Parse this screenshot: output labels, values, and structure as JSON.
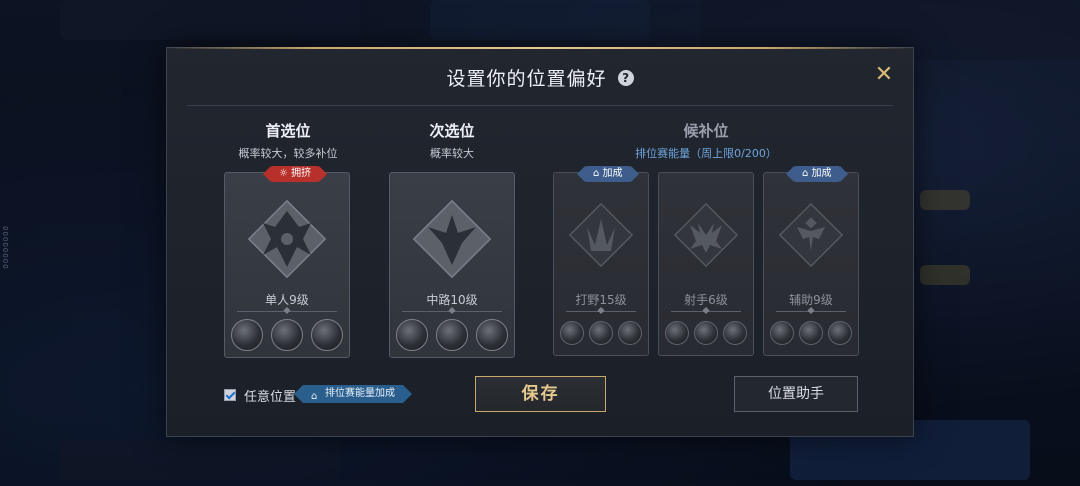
{
  "side_code": "00000000",
  "dialog": {
    "title": "设置你的位置偏好",
    "help_symbol": "?",
    "close_symbol": "✕"
  },
  "primary": {
    "title": "首选位",
    "subtitle": "概率较大，较多补位",
    "badge": "拥挤",
    "card": {
      "label": "单人9级",
      "heroes": [
        "hero-1",
        "hero-2",
        "hero-3"
      ]
    }
  },
  "secondary": {
    "title": "次选位",
    "subtitle": "概率较大",
    "card": {
      "label": "中路10级",
      "heroes": [
        "hero-1",
        "hero-2",
        "hero-3"
      ]
    }
  },
  "backup": {
    "title": "候补位",
    "subtitle": "排位赛能量（周上限0/200）",
    "cards": [
      {
        "label": "打野15级",
        "badge": "加成",
        "icon": "jungle-icon"
      },
      {
        "label": "射手6级",
        "badge": "",
        "icon": "marksman-icon"
      },
      {
        "label": "辅助9级",
        "badge": "加成",
        "icon": "support-icon"
      }
    ]
  },
  "footer": {
    "any_position_label": "任意位置",
    "any_position_checked": true,
    "any_position_badge": "排位赛能量加成",
    "save_label": "保存",
    "assistant_label": "位置助手"
  },
  "colors": {
    "gold": "#c9a96a",
    "crowded_red": "#b7302b",
    "bonus_blue": "#3f5d8c",
    "energy_text_blue": "#6fa5dd"
  }
}
